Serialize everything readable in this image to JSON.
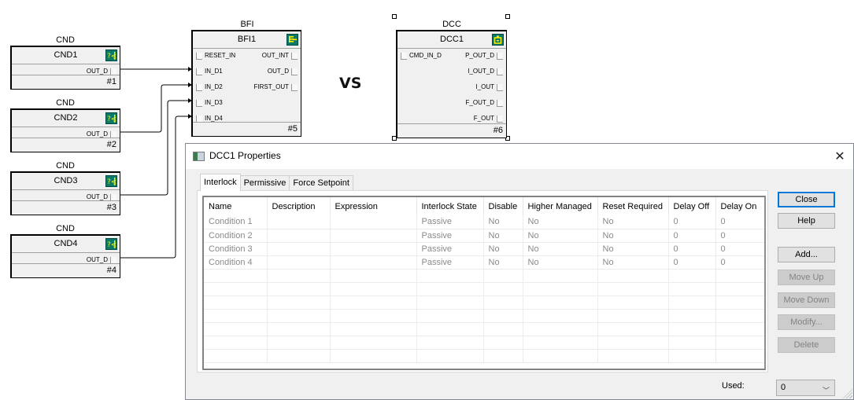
{
  "canvas": {
    "separator_text": "VS",
    "cnd_blocks": [
      {
        "type": "CND",
        "name": "CND1",
        "output": "OUT_D",
        "number": "#1"
      },
      {
        "type": "CND",
        "name": "CND2",
        "output": "OUT_D",
        "number": "#2"
      },
      {
        "type": "CND",
        "name": "CND3",
        "output": "OUT_D",
        "number": "#3"
      },
      {
        "type": "CND",
        "name": "CND4",
        "output": "OUT_D",
        "number": "#4"
      }
    ],
    "bfi_block": {
      "type": "BFI",
      "name": "BFI1",
      "inputs": [
        "RESET_IN",
        "IN_D1",
        "IN_D2",
        "IN_D3",
        "IN_D4"
      ],
      "outputs": [
        "OUT_INT",
        "OUT_D",
        "FIRST_OUT"
      ],
      "number": "#5"
    },
    "dcc_block": {
      "type": "DCC",
      "name": "DCC1",
      "inputs": [
        "CMD_IN_D"
      ],
      "outputs": [
        "P_OUT_D",
        "I_OUT_D",
        "I_OUT",
        "F_OUT_D",
        "F_OUT"
      ],
      "number": "#6"
    }
  },
  "dialog": {
    "title": "DCC1 Properties",
    "close_glyph": "✕",
    "tabs": [
      {
        "label": "Interlock",
        "active": true
      },
      {
        "label": "Permissive",
        "active": false
      },
      {
        "label": "Force Setpoint",
        "active": false
      }
    ],
    "table": {
      "columns": [
        "Name",
        "Description",
        "Expression",
        "Interlock State",
        "Disable",
        "Higher Managed",
        "Reset Required",
        "Delay Off",
        "Delay On"
      ],
      "rows": [
        [
          "Condition 1",
          "",
          "",
          "Passive",
          "No",
          "No",
          "No",
          "0",
          "0"
        ],
        [
          "Condition 2",
          "",
          "",
          "Passive",
          "No",
          "No",
          "No",
          "0",
          "0"
        ],
        [
          "Condition 3",
          "",
          "",
          "Passive",
          "No",
          "No",
          "No",
          "0",
          "0"
        ],
        [
          "Condition 4",
          "",
          "",
          "Passive",
          "No",
          "No",
          "No",
          "0",
          "0"
        ]
      ],
      "empty_row_count": 7
    },
    "buttons": {
      "close": "Close",
      "help": "Help",
      "add": "Add...",
      "move_up": "Move Up",
      "move_down": "Move Down",
      "modify": "Modify...",
      "delete": "Delete"
    },
    "used_label": "Used:",
    "used_value": "0",
    "used_chevron": "﹀"
  },
  "colors": {
    "focus_blue": "#0078d7",
    "icon_teal": "#0b7a6a",
    "icon_yellow": "#ffee00"
  }
}
